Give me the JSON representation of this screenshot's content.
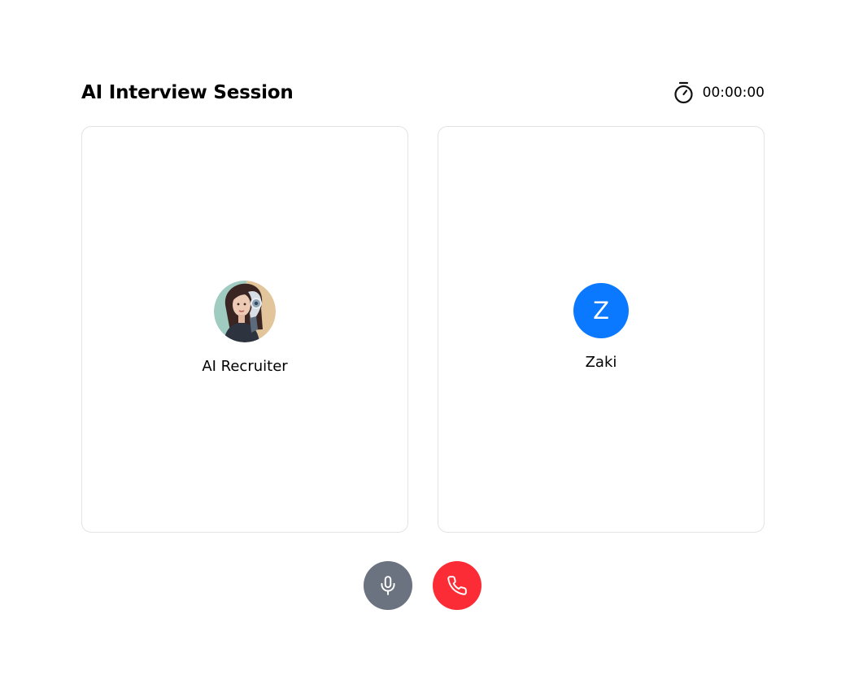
{
  "header": {
    "title": "AI Interview Session",
    "timer": "00:00:00",
    "timer_icon": "stopwatch-icon"
  },
  "participants": [
    {
      "name": "AI Recruiter",
      "avatar": "ai-recruiter-portrait"
    },
    {
      "name": "Zaki",
      "initial": "Z",
      "avatar_color": "#0a79ff"
    }
  ],
  "controls": {
    "mic_icon": "microphone-icon",
    "mic_color": "#6b7280",
    "end_icon": "phone-icon",
    "end_color": "#fb2c36"
  }
}
